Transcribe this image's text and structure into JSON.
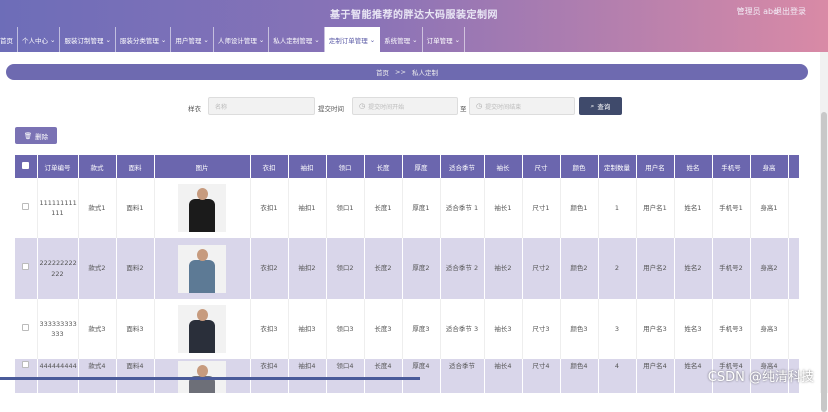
{
  "app_title": "基于智能推荐的胖达大码服装定制网",
  "user_label": "管理员 abo",
  "logout_label": "退出登录",
  "nav": [
    {
      "label": "首页",
      "arrow": false
    },
    {
      "label": "个人中心",
      "arrow": true
    },
    {
      "label": "服装订制管理",
      "arrow": true
    },
    {
      "label": "服装分类管理",
      "arrow": true
    },
    {
      "label": "用户管理",
      "arrow": true
    },
    {
      "label": "人师设计管理",
      "arrow": true
    },
    {
      "label": "私人定制管理",
      "arrow": true
    },
    {
      "label": "定制订单管理",
      "arrow": true,
      "active": true
    },
    {
      "label": "系统管理",
      "arrow": true
    },
    {
      "label": "订单管理",
      "arrow": true
    }
  ],
  "breadcrumb": {
    "home": "首页",
    "sep": ">>",
    "current": "私人定制"
  },
  "search": {
    "label1": "样衣",
    "placeholder1": "名称",
    "label2": "提交时间",
    "placeholder2": "提交时间开始",
    "label3": "至",
    "placeholder3": "提交时间结束",
    "button": "查询"
  },
  "delete_label": "删除",
  "table": {
    "headers": [
      "订单编号",
      "款式",
      "面料",
      "图片",
      "衣扣",
      "袖扣",
      "领口",
      "长度",
      "厚度",
      "适合季节",
      "袖长",
      "尺寸",
      "颜色",
      "定制数量",
      "用户名",
      "姓名",
      "手机号",
      "身高"
    ],
    "rows": [
      {
        "order": "111111111 111",
        "style": "款式1",
        "fabric": "面料1",
        "img_color": "#1b1b1b",
        "buttons": "衣扣1",
        "cuff": "袖扣1",
        "collar": "领口1",
        "length": "长度1",
        "thickness": "厚度1",
        "season": "适合季节 1",
        "sleeve": "袖长1",
        "size": "尺寸1",
        "color": "颜色1",
        "qty": "1",
        "username": "用户名1",
        "name": "姓名1",
        "phone": "手机号1",
        "height": "身高1"
      },
      {
        "order": "222222222 222",
        "style": "款式2",
        "fabric": "面料2",
        "img_color": "#5d7a95",
        "buttons": "衣扣2",
        "cuff": "袖扣2",
        "collar": "领口2",
        "length": "长度2",
        "thickness": "厚度2",
        "season": "适合季节 2",
        "sleeve": "袖长2",
        "size": "尺寸2",
        "color": "颜色2",
        "qty": "2",
        "username": "用户名2",
        "name": "姓名2",
        "phone": "手机号2",
        "height": "身高2"
      },
      {
        "order": "333333333 333",
        "style": "款式3",
        "fabric": "面料3",
        "img_color": "#2a2f3a",
        "buttons": "衣扣3",
        "cuff": "袖扣3",
        "collar": "领口3",
        "length": "长度3",
        "thickness": "厚度3",
        "season": "适合季节 3",
        "sleeve": "袖长3",
        "size": "尺寸3",
        "color": "颜色3",
        "qty": "3",
        "username": "用户名3",
        "name": "姓名3",
        "phone": "手机号3",
        "height": "身高3"
      },
      {
        "order": "444444444",
        "style": "款式4",
        "fabric": "面料4",
        "img_color": "#6d6f78",
        "buttons": "衣扣4",
        "cuff": "袖扣4",
        "collar": "领口4",
        "length": "长度4",
        "thickness": "厚度4",
        "season": "适合季节",
        "sleeve": "袖长4",
        "size": "尺寸4",
        "color": "颜色4",
        "qty": "4",
        "username": "用户名4",
        "name": "姓名4",
        "phone": "手机号4",
        "height": "身高4"
      }
    ]
  },
  "watermark": "CSDN @纯清科技"
}
